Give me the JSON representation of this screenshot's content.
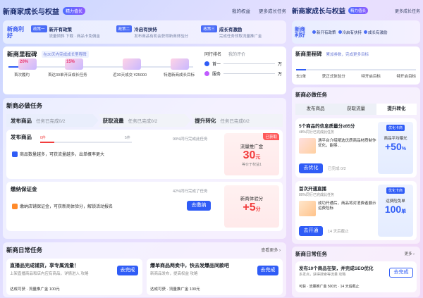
{
  "header": {
    "title": "新商家成长与权益",
    "badge": "精力值长",
    "links": [
      "我的权益",
      "更多成长任务"
    ]
  },
  "perks": {
    "logo": "新商利好",
    "items": [
      {
        "tag": "政策一",
        "title": "新开有政策",
        "sub": "流量倾斜 下载 · 商品卡免佣金"
      },
      {
        "tag": "政策二",
        "title": "冷启有扶持",
        "sub": "发布商品有机会获得新商体验分"
      },
      {
        "tag": "政策三",
        "title": "成长有激励",
        "sub": "完成任务领取流量推广金"
      }
    ]
  },
  "milestones": {
    "title": "新商里程碑",
    "sub": "在30天内完成成长里程碑",
    "gifts": [
      {
        "value": "20%",
        "label": "首次履约"
      },
      {
        "value": "15%",
        "label": "首达30单开店成长任务"
      },
      {
        "value": "",
        "label": "近30天成交 ¥25000"
      },
      {
        "value": "",
        "label": "特邀新商成长目标"
      }
    ],
    "rank": {
      "title": "同行排名",
      "hint": "我的评价",
      "rows": [
        {
          "label": "首一",
          "unit": "万"
        },
        {
          "label": "服务",
          "unit": "万"
        }
      ]
    }
  },
  "must": {
    "title": "新商必做任务",
    "steps": [
      {
        "name": "发布商品",
        "status": "任务已完成0/2"
      },
      {
        "name": "获取流量",
        "status": "任务已完成0/2"
      },
      {
        "name": "提升转化",
        "status": "任务已完成0/2"
      }
    ],
    "tasks": [
      {
        "name": "发布商品",
        "progress_left": "0件",
        "progress_right": "5件",
        "peer": "90%同行完成此任务",
        "note": "商品数量越多，可获流量越多，出单概率更大",
        "reward_tag": "已获取",
        "reward_label": "流量推广金",
        "reward_value": "30",
        "reward_unit": "元",
        "reward_sub": "等价于权益1"
      },
      {
        "name": "缴纳保证金",
        "peer": "42%同行完成了任务",
        "note": "缴纳店铺保证金，可获新商体验分，解锁活动报名",
        "button": "去缴纳",
        "reward_label": "新商体验分",
        "reward_value": "+5",
        "reward_unit": "分"
      }
    ]
  },
  "daily": {
    "title": "新商日常任务",
    "more": "查看更多 ›",
    "cards": [
      {
        "title": "直播品完成铺货，享专属流量！",
        "desc": "上架直播商品和店内应有商品，详情进入 攻略",
        "reward": "达成可获 · 流量推广金 100元",
        "button": "去完成"
      },
      {
        "title": "爆单商品两卖中，快去发爆品同款吧",
        "desc": "新商品发布，提高权益 攻略",
        "reward": "达成可获 · 流量推广金 100元",
        "button": "去完成"
      }
    ]
  },
  "right": {
    "header": {
      "title": "新商家成长与权益",
      "badge": "精力值长",
      "link": "更多成长任务"
    },
    "perks": {
      "logo": "新商利好",
      "items": [
        "新开有政策",
        "冷启有扶持",
        "成长有激励"
      ]
    },
    "milestones": {
      "title": "新商里程碑",
      "sub": "累加券数，完成更多目标",
      "labels": [
        "去1单",
        "获正式体验分",
        "特开启目标",
        "特开启目标"
      ]
    },
    "must": {
      "title": "新商必做任务",
      "tabs": [
        "发布商品",
        "获取流量",
        "提升转化"
      ],
      "tasks": [
        {
          "title": "5个商品的信息质量分≥85分",
          "sub": "48%同行已完成此任务",
          "desc": "遇平台介绍精选优质商品材质制作优化，能够...",
          "button": "去优化",
          "status": "已完成 0/2",
          "side_tag": "优化卡商",
          "side_label": "商品平均曝光",
          "side_value": "+50",
          "side_unit": "%"
        },
        {
          "title": "首次开通直播",
          "sub": "80%同行已完成此任务",
          "desc": "成功开通后，商品将对消费者展示运费险标",
          "button": "去开通",
          "status": "14 天后截止",
          "side_tag": "优化卡商",
          "side_label": "运费险免单",
          "side_value": "100",
          "side_unit": "单"
        }
      ]
    },
    "daily": {
      "title": "新商日常任务",
      "more": "更多 ›",
      "card": {
        "title": "发布10个商品在架，并完成SEO优化",
        "desc": "多发点，获得搜索等流量 攻略",
        "reward": "可获 · 流量推广金 500元 · 14 天后截止",
        "button": "去完成"
      }
    }
  }
}
